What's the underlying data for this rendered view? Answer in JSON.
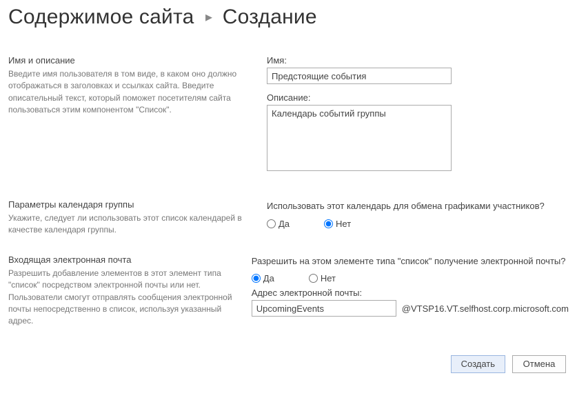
{
  "breadcrumb": {
    "parent": "Содержимое сайта",
    "current": "Создание",
    "separator": "▸"
  },
  "sections": {
    "name": {
      "title": "Имя и описание",
      "desc": "Введите имя пользователя в том виде, в каком оно должно отображаться в заголовках и ссылках сайта. Введите описательный текст, который поможет посетителям сайта пользоваться этим компонентом \"Список\".",
      "name_label": "Имя:",
      "name_value": "Предстоящие события",
      "desc_label": "Описание:",
      "desc_value": "Календарь событий группы"
    },
    "group_cal": {
      "title": "Параметры календаря группы",
      "desc": "Укажите, следует ли использовать этот список календарей в качестве календаря группы.",
      "question": "Использовать этот календарь для обмена графиками участников?",
      "yes": "Да",
      "no": "Нет",
      "selected": "no"
    },
    "email": {
      "title": "Входящая электронная почта",
      "desc": "Разрешить добавление элементов в этот элемент типа \"список\" посредством электронной почты или нет.  Пользователи смогут отправлять сообщения электронной почты непосредственно в список, используя указанный адрес.",
      "question": "Разрешить на этом элементе типа \"список\" получение электронной почты?",
      "yes": "Да",
      "no": "Нет",
      "selected": "yes",
      "addr_label": "Адрес электронной почты:",
      "addr_value": "UpcomingEvents",
      "domain": "@VTSP16.VT.selfhost.corp.microsoft.com"
    }
  },
  "buttons": {
    "create": "Создать",
    "cancel": "Отмена"
  }
}
